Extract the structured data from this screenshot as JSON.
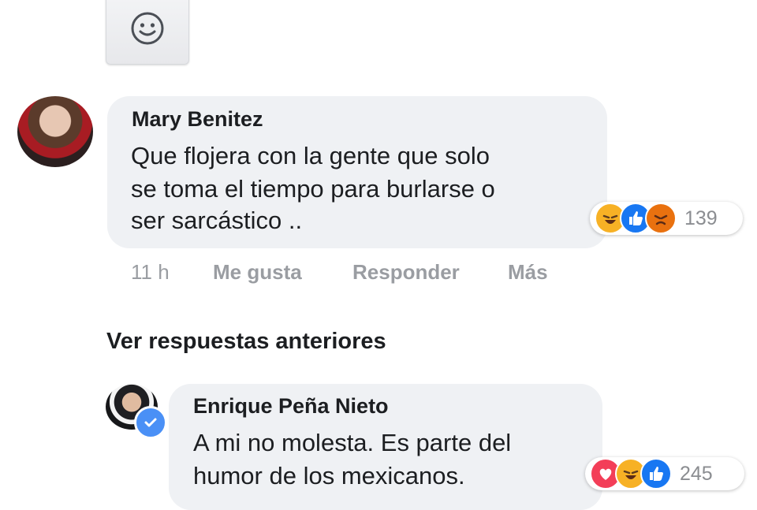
{
  "comments": [
    {
      "author": "Mary Benitez",
      "text_lines": [
        "Que flojera con la gente que solo",
        "se toma el tiempo para burlarse o",
        "ser sarcástico .."
      ],
      "reactions": {
        "icons": [
          "haha",
          "like",
          "angry"
        ],
        "count": "139"
      },
      "meta": {
        "time": "11 h",
        "like": "Me gusta",
        "reply": "Responder",
        "more": "Más"
      }
    }
  ],
  "replies_link": "Ver respuestas anteriores",
  "reply": {
    "author": "Enrique Peña Nieto",
    "text_lines": [
      "A mi no molesta. Es parte del",
      "humor de los mexicanos."
    ],
    "reactions": {
      "icons": [
        "love",
        "haha",
        "like"
      ],
      "count": "245"
    },
    "verified": true
  },
  "icons": {
    "emoji_button": "smiley-icon",
    "verified": "check-badge-icon"
  },
  "colors": {
    "bubble": "#eff1f4",
    "like": "#1877f2",
    "love": "#f33e58",
    "haha": "#f7b125",
    "angry": "#e9710f",
    "meta_text": "#9a9da2"
  }
}
